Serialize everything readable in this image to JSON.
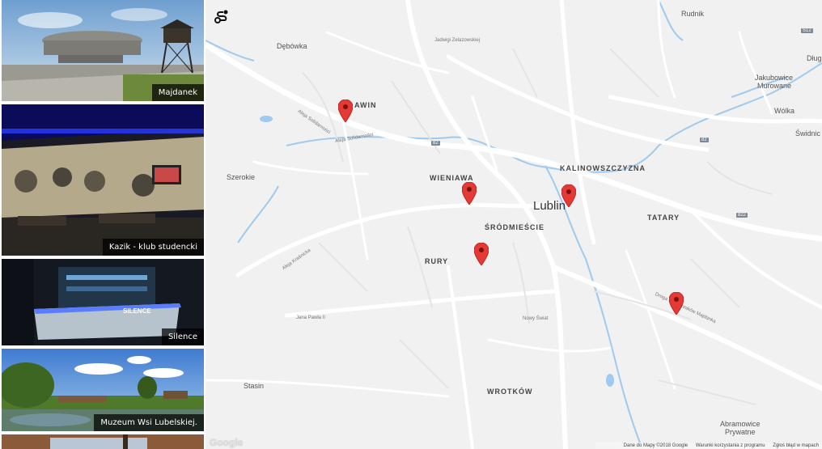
{
  "sidebar": {
    "cards": [
      {
        "label": "Majdanek"
      },
      {
        "label": "Kazik - klub studencki"
      },
      {
        "label": "Silence"
      },
      {
        "label": "Muzeum Wsi Lubelskiej."
      }
    ]
  },
  "map": {
    "city": "Lublin",
    "districts": {
      "slawin": "AWIN",
      "wieniawa": "WIENIAWA",
      "kalinowszczyzna": "KALINOWSZCZYZNA",
      "srodmiescie": "ŚRÓDMIEŚCIE",
      "tatary": "TATARY",
      "rury": "RURY",
      "wrotkow": "WROTKÓW"
    },
    "places": {
      "rudnik": "Rudnik",
      "debowka": "Dębówka",
      "dlugi": "Dług",
      "jakubowice": "Jakubowice",
      "murowane": "Murowane",
      "wolka": "Wólka",
      "swidnik": "Świdnic",
      "szerokie": "Szerokie",
      "stasin": "Stasin",
      "abramowice": "Abramowice",
      "prywatne": "Prywatne"
    },
    "roads": {
      "solidarnosci1": "Aleja Solidarności",
      "solidarnosci2": "Aleja Solidarności",
      "zelazowskiej": "Jadwigi Zelazowskiej",
      "krasnicka": "Aleja Kraśnicka",
      "pawla": "Jana Pawła II",
      "droga": "Droga Męczenników Majdanka",
      "nowy_swiat": "Nowy Świat"
    },
    "shields": {
      "s12": "S12",
      "s82a": "82",
      "s82b": "82",
      "s82c": "822"
    },
    "google_logo": "Google",
    "attribution": {
      "data": "Dane do Mapy ©2018 Google",
      "terms": "Warunki korzystania z programu",
      "report": "Zgłoś błąd w mapach"
    },
    "colors": {
      "pin": "#e53935",
      "water": "#9ecaf0",
      "road": "#ffffff",
      "background": "#f1f1f1"
    }
  }
}
